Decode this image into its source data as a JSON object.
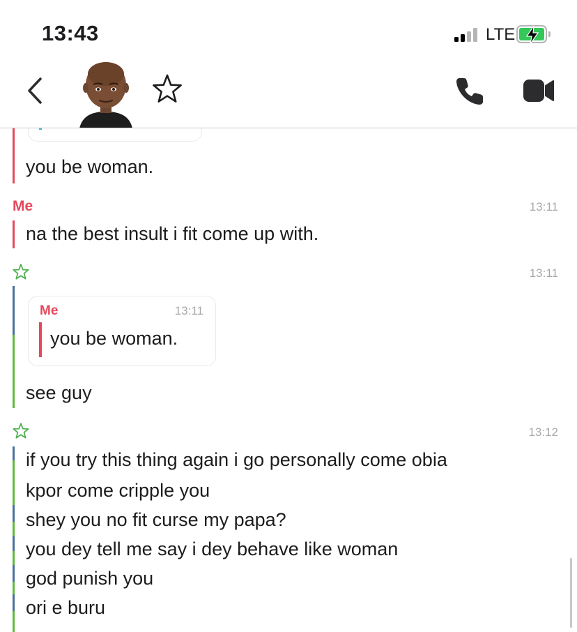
{
  "status_bar": {
    "time": "13:43",
    "network": "LTE"
  },
  "header": {
    "icons": [
      "back-chevron-icon",
      "avatar",
      "star-icon",
      "phone-icon",
      "video-icon"
    ]
  },
  "messages": {
    "m0_text": "you be woman.",
    "me_sender": "Me",
    "m1_time": "13:11",
    "m1_text": "na the best insult i fit come up with.",
    "m2_time": "13:11",
    "m2_quote_sender": "Me",
    "m2_quote_time": "13:11",
    "m2_quote_text": "you be woman.",
    "m2_text": "see guy",
    "m3_time": "13:12",
    "m3_lines": [
      "if you try this thing again i go personally come obia",
      "kpor come cripple you",
      "shey you no fit curse my papa?",
      "you dey tell me say i dey behave like woman",
      "god punish you",
      "ori e buru"
    ]
  },
  "colors": {
    "me": "#e5485b",
    "friend_star": "#4cae4c",
    "friend_bar_green": "#5dbb3a",
    "friend_bar_blue": "#4a6f9c"
  }
}
